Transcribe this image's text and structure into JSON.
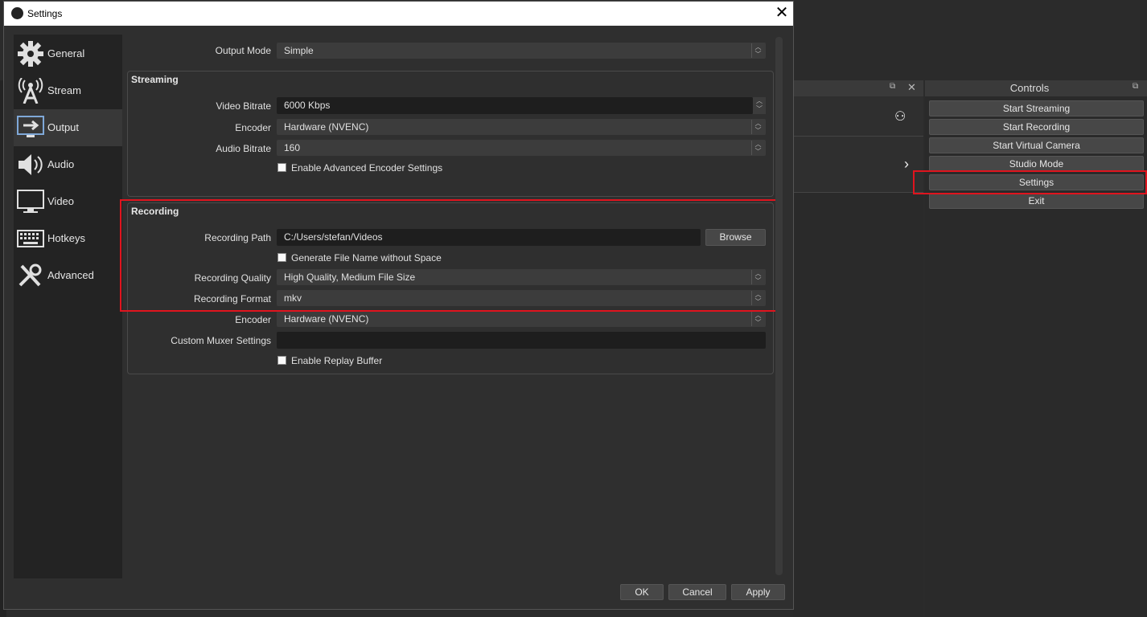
{
  "window": {
    "title": "Settings"
  },
  "sidebar": {
    "items": [
      {
        "label": "General",
        "icon": "gear-icon"
      },
      {
        "label": "Stream",
        "icon": "antenna-icon"
      },
      {
        "label": "Output",
        "icon": "output-monitor-icon"
      },
      {
        "label": "Audio",
        "icon": "speaker-icon"
      },
      {
        "label": "Video",
        "icon": "monitor-icon"
      },
      {
        "label": "Hotkeys",
        "icon": "keyboard-icon"
      },
      {
        "label": "Advanced",
        "icon": "tools-icon"
      }
    ],
    "active": "Output"
  },
  "output": {
    "mode_label": "Output Mode",
    "mode_value": "Simple",
    "streaming": {
      "title": "Streaming",
      "video_bitrate_label": "Video Bitrate",
      "video_bitrate_value": "6000 Kbps",
      "encoder_label": "Encoder",
      "encoder_value": "Hardware (NVENC)",
      "audio_bitrate_label": "Audio Bitrate",
      "audio_bitrate_value": "160",
      "advanced_encoder_label": "Enable Advanced Encoder Settings"
    },
    "recording": {
      "title": "Recording",
      "path_label": "Recording Path",
      "path_value": "C:/Users/stefan/Videos",
      "browse_label": "Browse",
      "no_space_label": "Generate File Name without Space",
      "quality_label": "Recording Quality",
      "quality_value": "High Quality, Medium File Size",
      "format_label": "Recording Format",
      "format_value": "mkv",
      "encoder_label": "Encoder",
      "encoder_value": "Hardware (NVENC)",
      "muxer_label": "Custom Muxer Settings",
      "muxer_value": "",
      "replay_label": "Enable Replay Buffer"
    }
  },
  "footer": {
    "ok": "OK",
    "cancel": "Cancel",
    "apply": "Apply"
  },
  "controls": {
    "title": "Controls",
    "buttons": [
      "Start Streaming",
      "Start Recording",
      "Start Virtual Camera",
      "Studio Mode",
      "Settings",
      "Exit"
    ]
  },
  "colors": {
    "highlight": "#e0141e",
    "panel": "#2f2f2f",
    "sidebar": "#232323"
  }
}
